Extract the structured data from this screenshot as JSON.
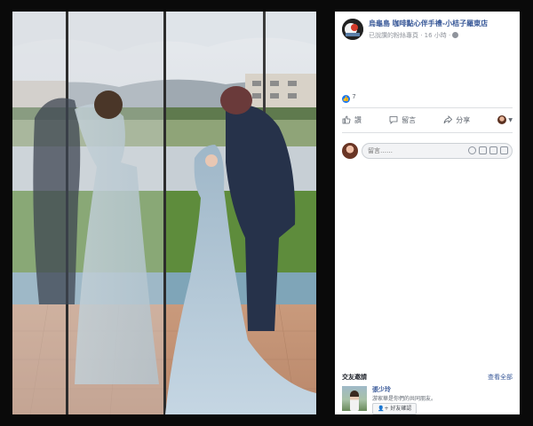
{
  "post": {
    "page_name": "烏龜島 咖啡點心伴手禮-小桔子羅東店",
    "meta": "已說讚的粉絲專頁 · 16 小時 ·",
    "visibility_icon": "globe-icon"
  },
  "reactions": {
    "count": "7",
    "icon": "like-icon"
  },
  "actions": {
    "like": "讚",
    "comment": "留言",
    "share": "分享"
  },
  "comment": {
    "placeholder": "留言……"
  },
  "suggestions": {
    "title": "交友邀請",
    "see_all": "查看全部",
    "friend": {
      "name": "張少玲",
      "mutual": "游家華是你們的共同朋友。",
      "confirm_label": "好友確認"
    }
  },
  "colors": {
    "link_blue": "#385898",
    "like_blue": "#1877f2",
    "muted_text": "#90949c",
    "backdrop": "#0a0a0a"
  }
}
